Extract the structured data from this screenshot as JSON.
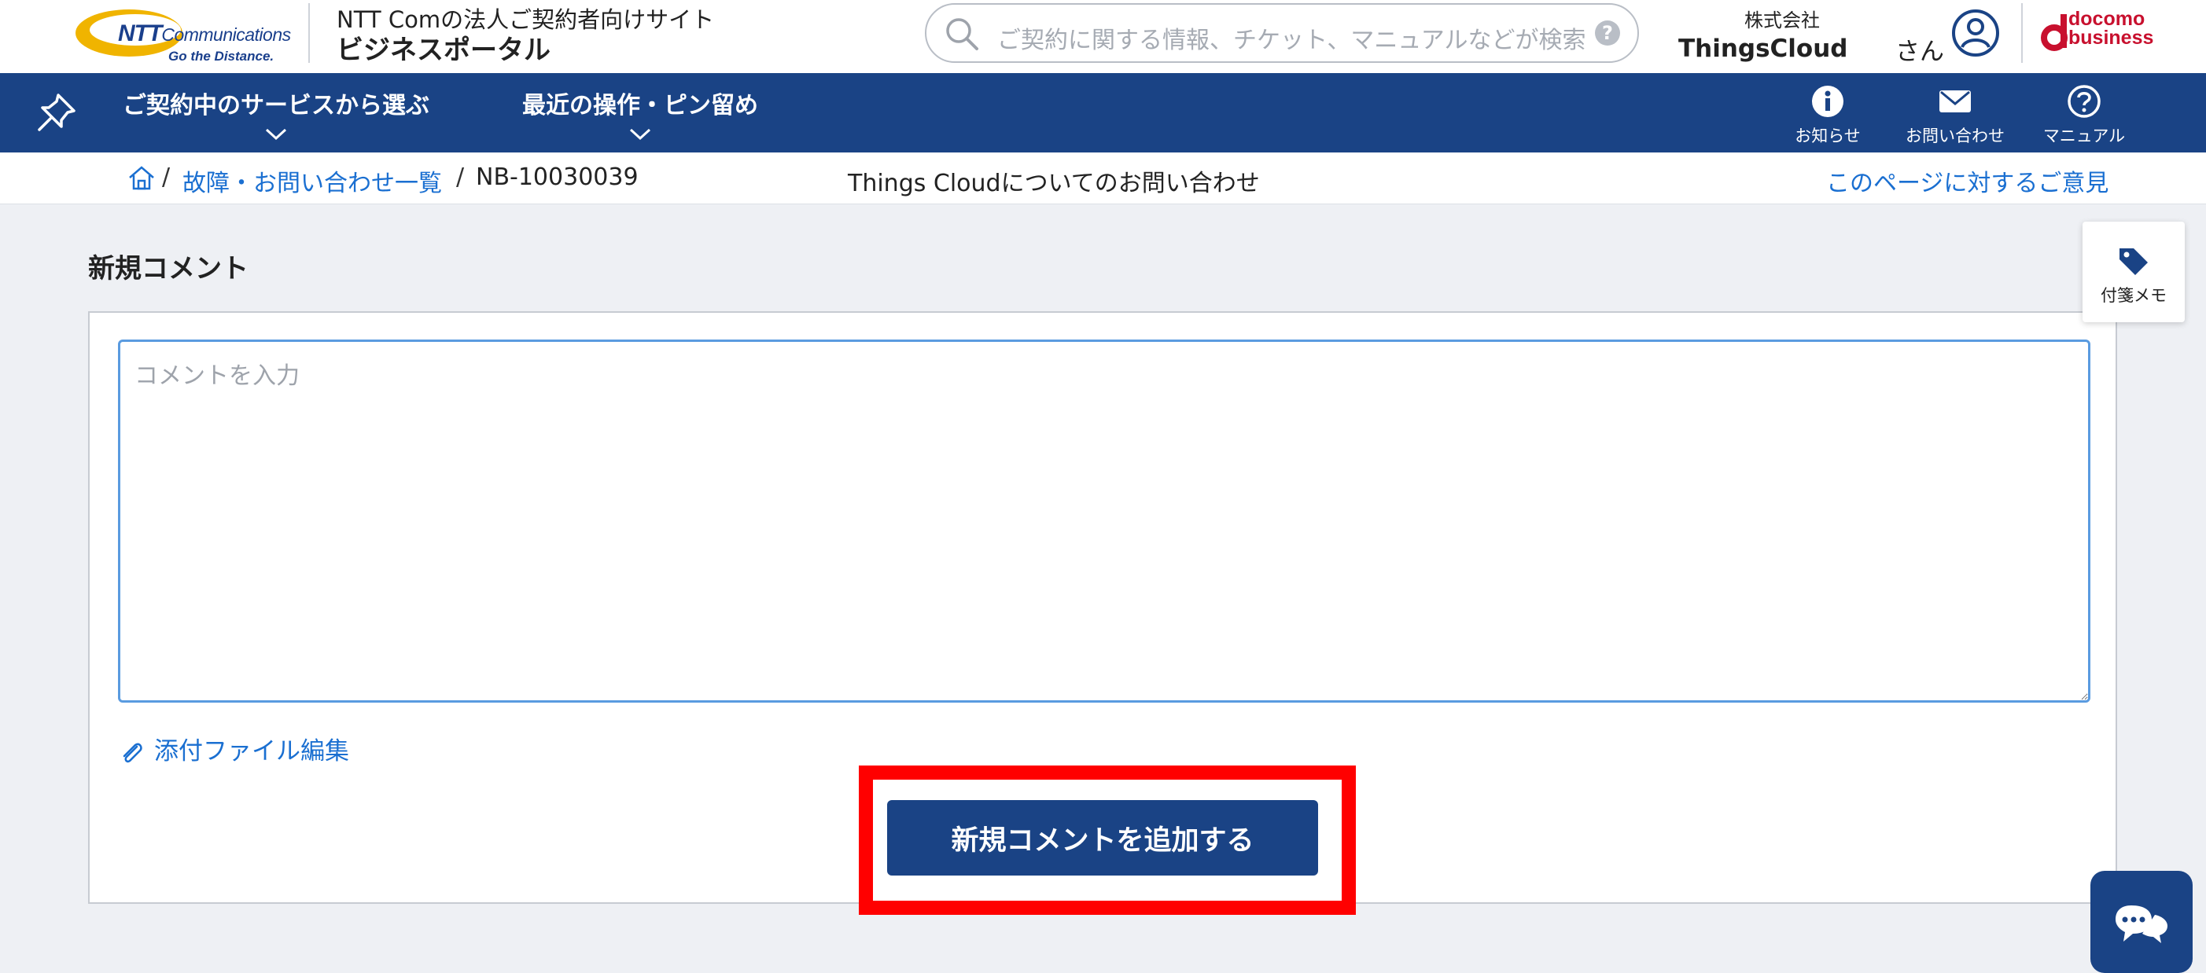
{
  "header": {
    "logo": {
      "brand": "NTT",
      "brand_sub": "Communications",
      "tagline": "Go the Distance."
    },
    "site_subtitle": "NTT Comの法人ご契約者向けサイト",
    "site_title": "ビジネスポータル",
    "search": {
      "placeholder": "ご契約に関する情報、チケット、マニュアルなどが検索",
      "help_glyph": "?"
    },
    "company_kind": "株式会社",
    "company_name": "ThingsCloud",
    "user_suffix": "さん",
    "partner_logo": {
      "line1": "docomo",
      "line2": "business"
    }
  },
  "navbar": {
    "menus": [
      {
        "label": "ご契約中のサービスから選ぶ"
      },
      {
        "label": "最近の操作・ピン留め"
      }
    ],
    "icons": [
      {
        "label": "お知らせ",
        "icon": "info-icon"
      },
      {
        "label": "お問い合わせ",
        "icon": "mail-icon"
      },
      {
        "label": "マニュアル",
        "icon": "help-icon"
      }
    ]
  },
  "breadcrumb": {
    "items": [
      "故障・お問い合わせ一覧",
      "NB-10030039"
    ],
    "separator": "/",
    "ticket_subject": "Things Cloudについてのお問い合わせ",
    "feedback_link": "このページに対するご意見"
  },
  "main": {
    "section_title": "新規コメント",
    "comment_placeholder": "コメントを入力",
    "comment_value": "",
    "attach_label": "添付ファイル編集",
    "submit_label": "新規コメントを追加する"
  },
  "floating": {
    "memo_label": "付箋メモ"
  },
  "colors": {
    "navy": "#1a4385",
    "link": "#1a6fd1",
    "highlight": "#ff0000",
    "docomo_red": "#c8102e"
  }
}
